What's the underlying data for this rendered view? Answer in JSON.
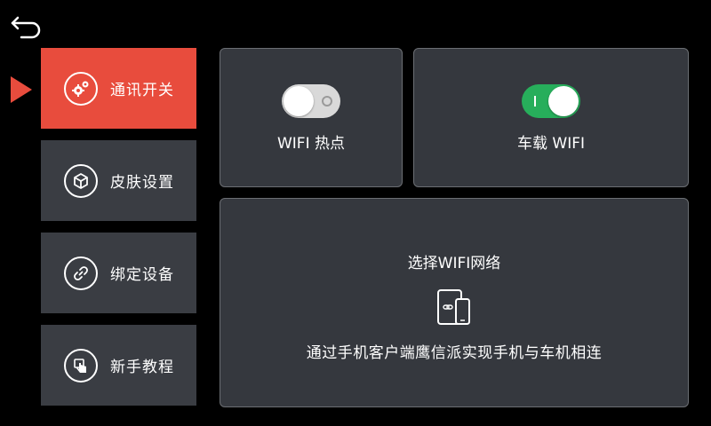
{
  "back": {
    "icon": "back-arrow-icon"
  },
  "sidebar": {
    "pointer_color": "#e84c3d",
    "items": [
      {
        "label": "通讯开关",
        "icon": "gears-icon",
        "active": true
      },
      {
        "label": "皮肤设置",
        "icon": "cube-icon",
        "active": false
      },
      {
        "label": "绑定设备",
        "icon": "link-icon",
        "active": false
      },
      {
        "label": "新手教程",
        "icon": "hand-touch-icon",
        "active": false
      }
    ]
  },
  "toggles": {
    "hotspot": {
      "label": "WIFI 热点",
      "state": "off"
    },
    "car_wifi": {
      "label": "车载 WIFI",
      "state": "on"
    }
  },
  "wifi_select": {
    "title": "选择WIFI网络",
    "icon": "tablet-phone-link-icon",
    "description": "通过手机客户端鹰信派实现手机与车机相连"
  },
  "colors": {
    "background": "#000000",
    "menu_bg": "#3a3d43",
    "menu_active": "#e84c3d",
    "panel_bg": "#35383e",
    "switch_on": "#27ae5b",
    "switch_off": "#d9d9d9"
  }
}
